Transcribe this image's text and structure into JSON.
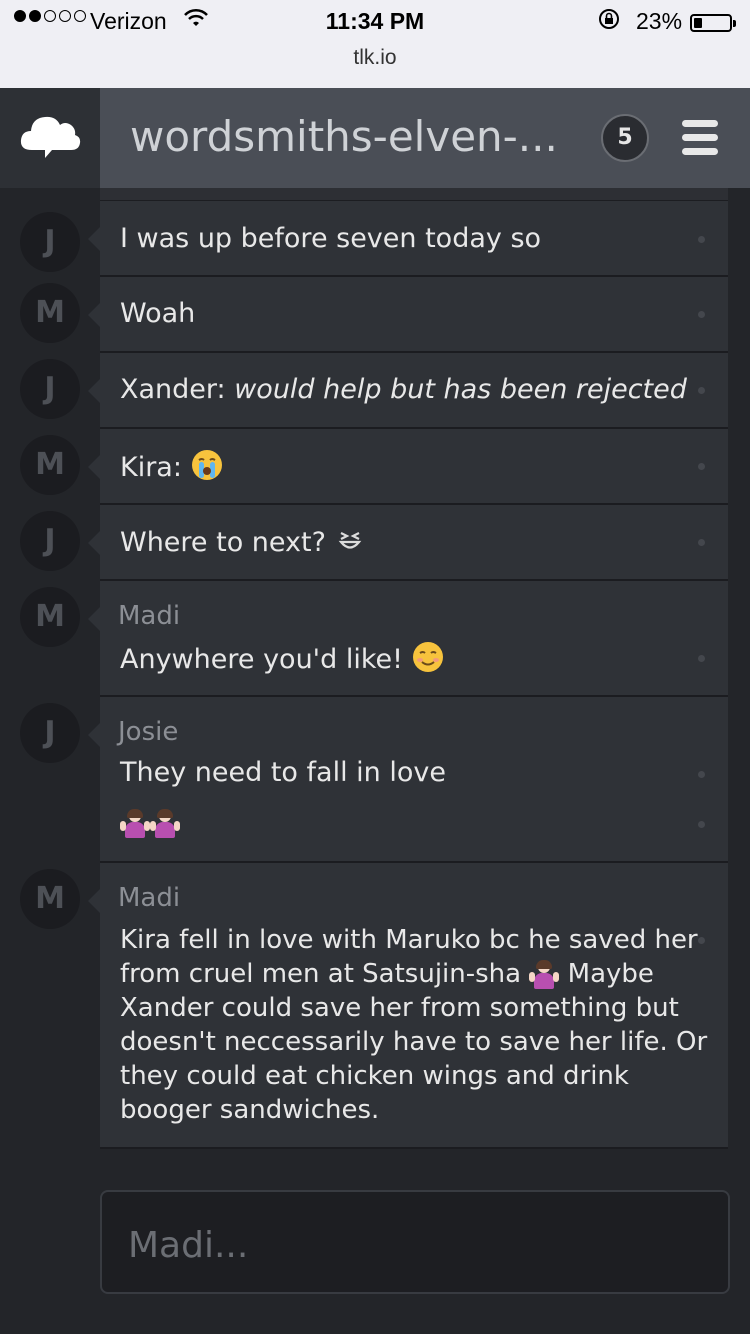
{
  "status_bar": {
    "carrier": "Verizon",
    "time": "11:34 PM",
    "battery": "23%",
    "battery_level": 0.23,
    "url": "tlk.io"
  },
  "header": {
    "title": "wordsmiths-elven-...",
    "user_count": "5",
    "icons": [
      "cloud-logo-icon",
      "hamburger-menu-icon"
    ]
  },
  "messages": [
    {
      "initial": "J",
      "text": "I was up before seven today so"
    },
    {
      "initial": "M",
      "text": "Woah"
    },
    {
      "initial": "J",
      "prefix": "Xander: ",
      "text": "would help but has been rejected"
    },
    {
      "initial": "M",
      "text": "Kira: ",
      "emoji": "crying-face-emoji"
    },
    {
      "initial": "J",
      "text": "Where to next? ",
      "emoji": "grinning-squinting-face-emoji"
    },
    {
      "initial": "M",
      "author": "Madi",
      "text": "Anywhere you'd like! ",
      "emoji": "smiling-face-emoji"
    },
    {
      "initial": "J",
      "author": "Josie",
      "text": "They need to fall in love",
      "emoji": "shrugging-person-emoji"
    },
    {
      "initial": "M",
      "author": "Madi",
      "text_a": "Kira fell in love with Maruko bc he saved her from cruel men at Satsujin-sha",
      "text_b": " Maybe Xander could save her from something but doesn't neccessarily have to save her life. Or they could eat chicken wings and drink booger sandwiches.",
      "emoji": "shrugging-person-emoji"
    }
  ],
  "compose": {
    "placeholder": "Madi..."
  },
  "colors": {
    "background": "#232529",
    "header": "#4a4e56",
    "bubble": "#2f3237",
    "author": "#8c8f95"
  }
}
